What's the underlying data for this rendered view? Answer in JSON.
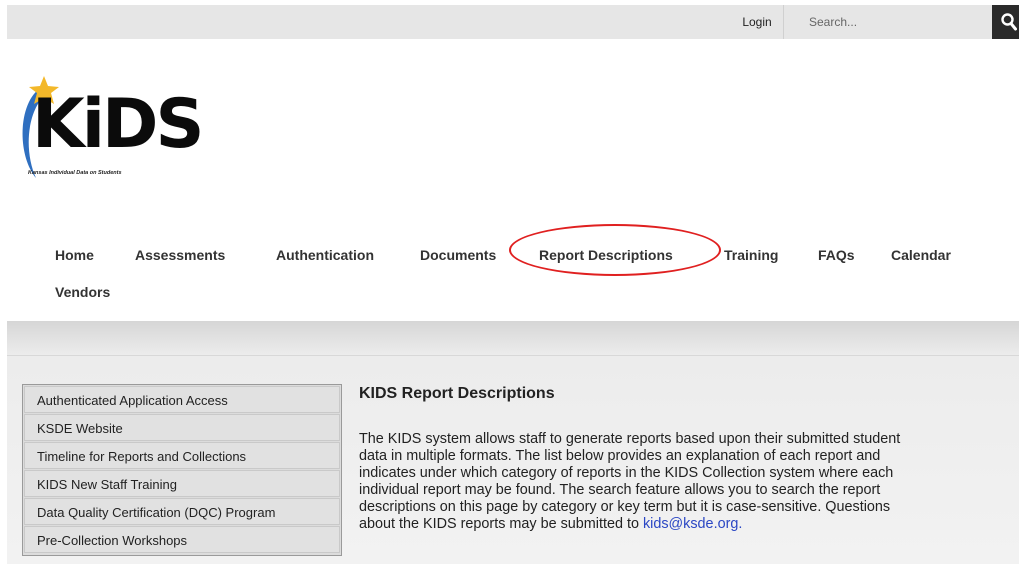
{
  "topbar": {
    "login_label": "Login",
    "search_placeholder": "Search...",
    "search_icon": "search-icon"
  },
  "logo": {
    "text": "KiDS",
    "tagline": "Kansas Individual Data on Students",
    "colors": {
      "star": "#f3b82a",
      "swoosh": "#2f6fc0",
      "text": "#0b0b0b"
    }
  },
  "nav": {
    "items": [
      {
        "label": "Home"
      },
      {
        "label": "Assessments"
      },
      {
        "label": "Authentication"
      },
      {
        "label": "Documents"
      },
      {
        "label": "Report Descriptions"
      },
      {
        "label": "Training"
      },
      {
        "label": "FAQs"
      },
      {
        "label": "Calendar"
      },
      {
        "label": "Vendors"
      }
    ],
    "highlight_color": "#e02020"
  },
  "sidebar": {
    "items": [
      {
        "label": "Authenticated Application Access"
      },
      {
        "label": "KSDE Website"
      },
      {
        "label": "Timeline for Reports and Collections"
      },
      {
        "label": "KIDS New Staff Training"
      },
      {
        "label": "Data Quality Certification (DQC) Program"
      },
      {
        "label": "Pre-Collection Workshops"
      }
    ]
  },
  "content": {
    "title": "KIDS Report Descriptions",
    "body_line_1": "The KIDS system allows staff to generate reports based upon their submitted student",
    "body_line_2": "data in multiple formats. The list below provides an explanation of each report and",
    "body_line_3": "indicates under which category of reports in the KIDS Collection system where each",
    "body_line_4": "individual report may be found. The search feature allows you to search the report",
    "body_line_5": "descriptions on this page by category or key term but it is case-sensitive. Questions",
    "body_line_6": "about the KIDS reports may be submitted to",
    "email": "kids@ksde.org",
    "email_suffix": ".",
    "link_color": "#2b47c4"
  }
}
